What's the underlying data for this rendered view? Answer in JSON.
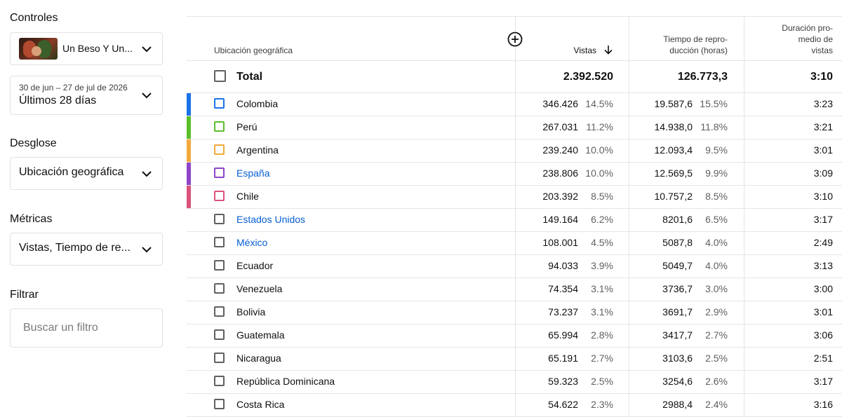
{
  "left": {
    "controls_label": "Controles",
    "video_title": "Un Beso Y Un...",
    "date_range": "30 de jun – 27 de jul de 2026",
    "date_preset": "Últimos 28 días",
    "breakdown_label": "Desglose",
    "breakdown_value": "Ubicación geográfica",
    "metrics_label": "Métricas",
    "metrics_value": "Vistas, Tiempo de re...",
    "filter_label": "Filtrar",
    "filter_placeholder": "Buscar un filtro"
  },
  "table": {
    "headers": {
      "geo": "Ubicación geográfica",
      "views": "Vistas",
      "watch_line1": "Tiempo de repro-",
      "watch_line2": "ducción (horas)",
      "dur_line1": "Duración pro-",
      "dur_line2": "medio de",
      "dur_line3": "vistas"
    },
    "total": {
      "label": "Total",
      "views": "2.392.520",
      "watch": "126.773,3",
      "duration": "3:10"
    },
    "rows": [
      {
        "country": "Colombia",
        "views": "346.426",
        "views_pct": "14.5%",
        "watch": "19.587,6",
        "watch_pct": "15.5%",
        "duration": "3:23",
        "color": "#1a73e8",
        "link": false
      },
      {
        "country": "Perú",
        "views": "267.031",
        "views_pct": "11.2%",
        "watch": "14.938,0",
        "watch_pct": "11.8%",
        "duration": "3:21",
        "color": "#5cbf2a",
        "link": false
      },
      {
        "country": "Argentina",
        "views": "239.240",
        "views_pct": "10.0%",
        "watch": "12.093,4",
        "watch_pct": "9.5%",
        "duration": "3:01",
        "color": "#f2a93b",
        "link": false
      },
      {
        "country": "España",
        "views": "238.806",
        "views_pct": "10.0%",
        "watch": "12.569,5",
        "watch_pct": "9.9%",
        "duration": "3:09",
        "color": "#8e44c8",
        "link": true
      },
      {
        "country": "Chile",
        "views": "203.392",
        "views_pct": "8.5%",
        "watch": "10.757,2",
        "watch_pct": "8.5%",
        "duration": "3:10",
        "color": "#d9537a",
        "link": false
      },
      {
        "country": "Estados Unidos",
        "views": "149.164",
        "views_pct": "6.2%",
        "watch": "8201,6",
        "watch_pct": "6.5%",
        "duration": "3:17",
        "color": "",
        "link": true
      },
      {
        "country": "México",
        "views": "108.001",
        "views_pct": "4.5%",
        "watch": "5087,8",
        "watch_pct": "4.0%",
        "duration": "2:49",
        "color": "",
        "link": true
      },
      {
        "country": "Ecuador",
        "views": "94.033",
        "views_pct": "3.9%",
        "watch": "5049,7",
        "watch_pct": "4.0%",
        "duration": "3:13",
        "color": "",
        "link": false
      },
      {
        "country": "Venezuela",
        "views": "74.354",
        "views_pct": "3.1%",
        "watch": "3736,7",
        "watch_pct": "3.0%",
        "duration": "3:00",
        "color": "",
        "link": false
      },
      {
        "country": "Bolivia",
        "views": "73.237",
        "views_pct": "3.1%",
        "watch": "3691,7",
        "watch_pct": "2.9%",
        "duration": "3:01",
        "color": "",
        "link": false
      },
      {
        "country": "Guatemala",
        "views": "65.994",
        "views_pct": "2.8%",
        "watch": "3417,7",
        "watch_pct": "2.7%",
        "duration": "3:06",
        "color": "",
        "link": false
      },
      {
        "country": "Nicaragua",
        "views": "65.191",
        "views_pct": "2.7%",
        "watch": "3103,6",
        "watch_pct": "2.5%",
        "duration": "2:51",
        "color": "",
        "link": false
      },
      {
        "country": "República Dominicana",
        "views": "59.323",
        "views_pct": "2.5%",
        "watch": "3254,6",
        "watch_pct": "2.6%",
        "duration": "3:17",
        "color": "",
        "link": false
      },
      {
        "country": "Costa Rica",
        "views": "54.622",
        "views_pct": "2.3%",
        "watch": "2988,4",
        "watch_pct": "2.4%",
        "duration": "3:16",
        "color": "",
        "link": false
      }
    ]
  },
  "icons": {
    "dropdown": "chevron-down-icon",
    "sort": "arrow-down-icon",
    "add_column": "add-circle-icon",
    "checkbox": "checkbox-icon"
  }
}
